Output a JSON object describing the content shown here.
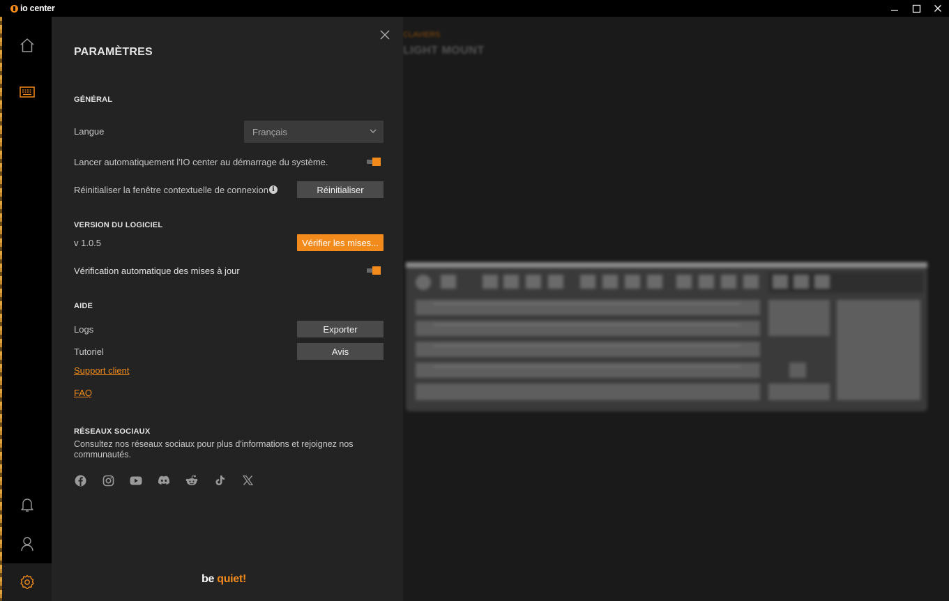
{
  "titlebar": {
    "app_name": "io center"
  },
  "background": {
    "breadcrumb": "CLAVIERS",
    "device_title": "LIGHT MOUNT"
  },
  "settings": {
    "title": "PARAMÈTRES",
    "general": {
      "heading": "GÉNÉRAL",
      "language_label": "Langue",
      "language_value": "Français",
      "autostart_label": "Lancer automatiquement l'IO center au démarrage du système.",
      "autostart_enabled": true,
      "reset_popup_label": "Réinitialiser la fenêtre contextuelle de connexion",
      "reset_button": "Réinitialiser"
    },
    "version": {
      "heading": "VERSION DU LOGICIEL",
      "version_value": "v 1.0.5",
      "check_button": "Vérifier les mises...",
      "auto_check_label": "Vérification automatique des mises à jour",
      "auto_check_enabled": true
    },
    "help": {
      "heading": "AIDE",
      "logs_label": "Logs",
      "export_button": "Exporter",
      "tutorial_label": "Tutoriel",
      "review_button": "Avis",
      "support_link": "Support client",
      "faq_link": "FAQ"
    },
    "social": {
      "heading": "RÉSEAUX SOCIAUX",
      "description": "Consultez nos réseaux sociaux pour plus d'informations et rejoignez nos communautés.",
      "icons": [
        "facebook-icon",
        "instagram-icon",
        "youtube-icon",
        "discord-icon",
        "reddit-icon",
        "tiktok-icon",
        "x-icon"
      ]
    },
    "brand": {
      "part1": "be ",
      "part2": "quiet!"
    }
  },
  "colors": {
    "accent": "#f28b1c",
    "panel": "#232323",
    "sidebar": "#000000"
  }
}
